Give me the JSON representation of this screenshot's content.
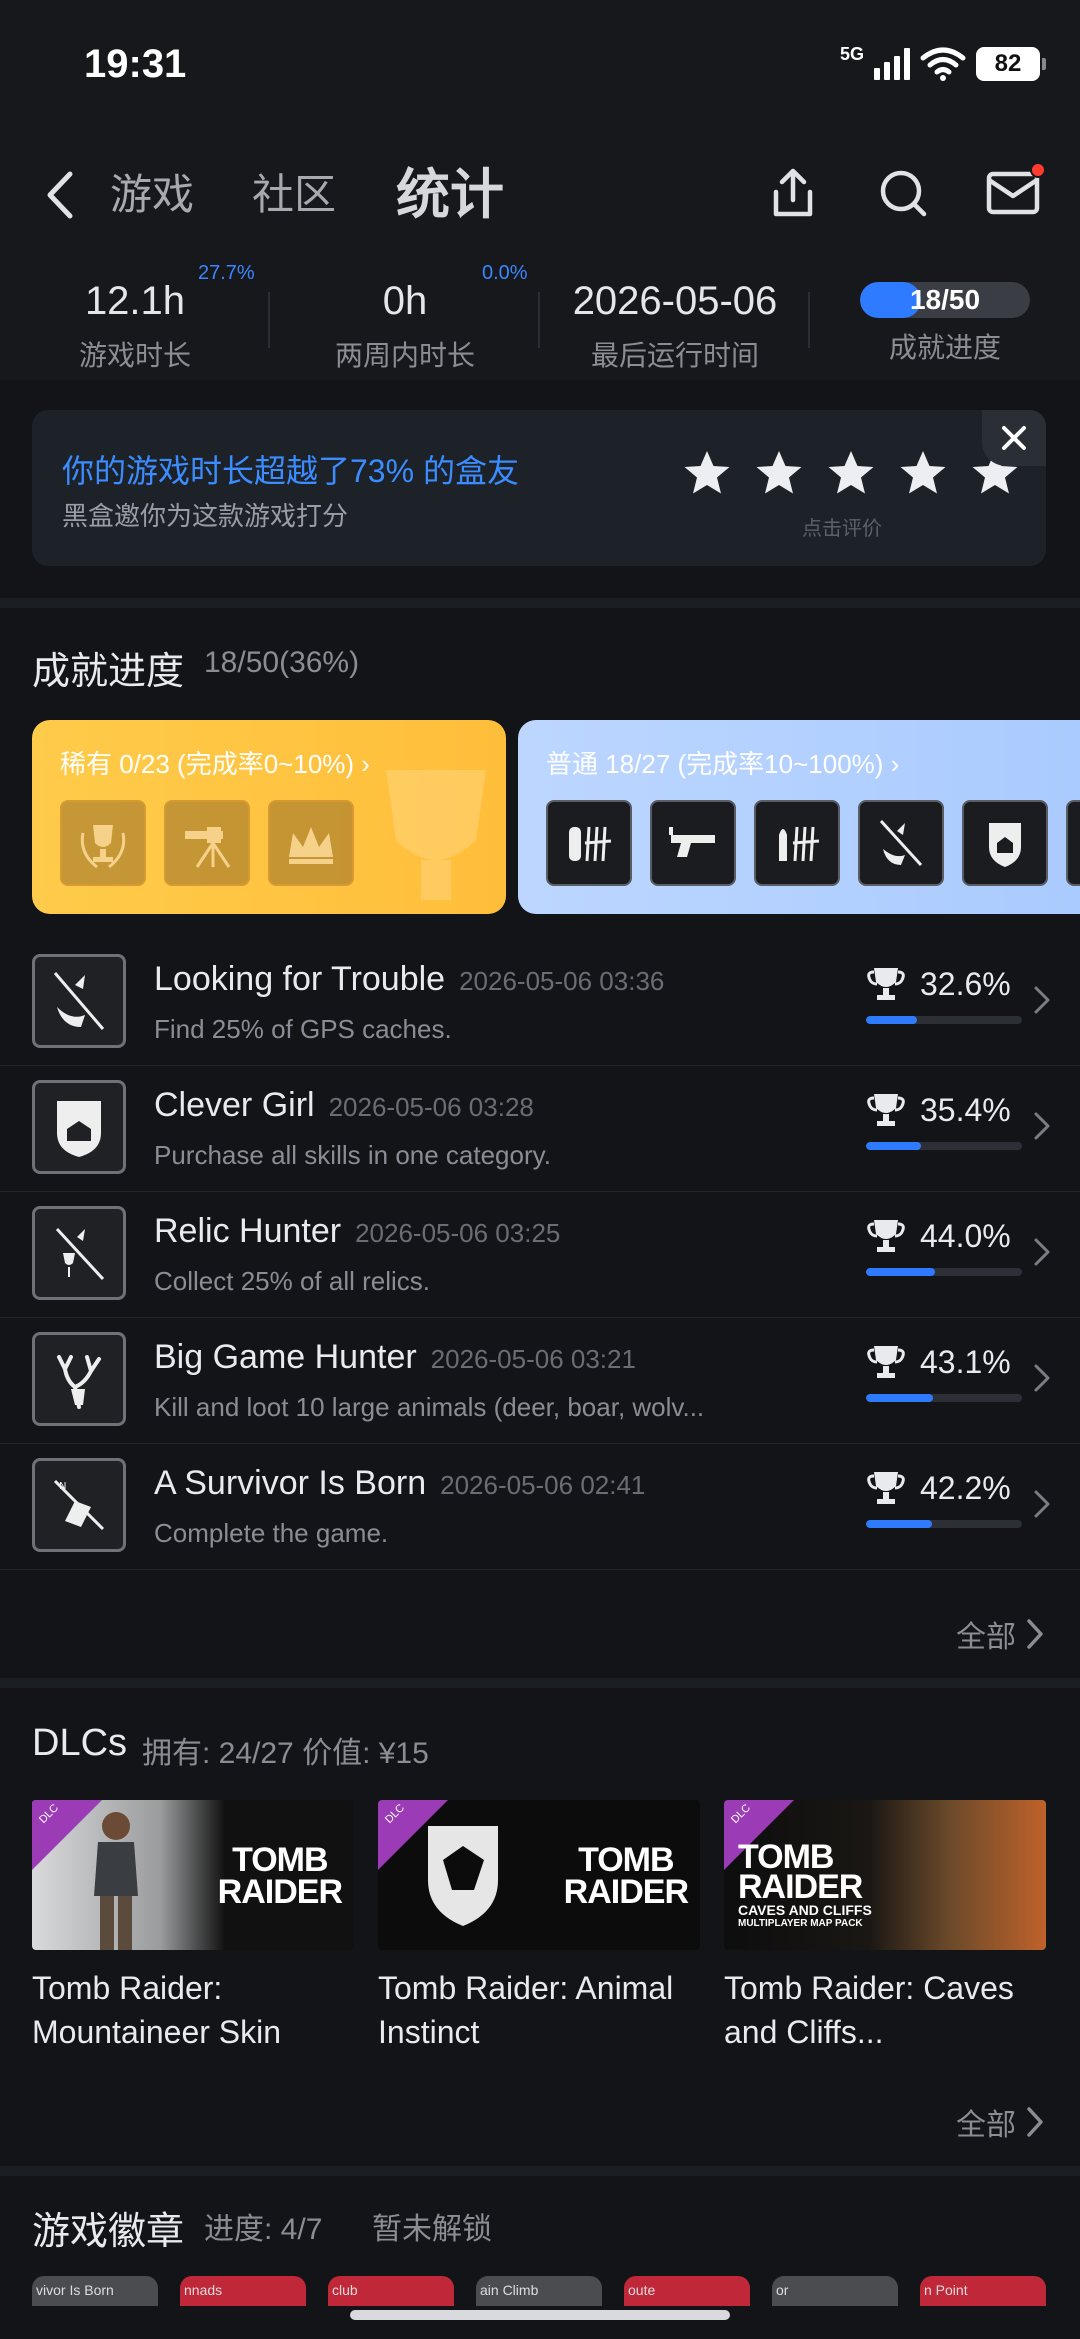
{
  "status": {
    "time": "19:31",
    "network": "5G",
    "battery": "82"
  },
  "nav": {
    "tabs": [
      "游戏",
      "社区",
      "统计"
    ],
    "active_tab": "统计"
  },
  "stats": [
    {
      "value": "12.1h",
      "delta": "27.7%",
      "label": "游戏时长"
    },
    {
      "value": "0h",
      "delta": "0.0%",
      "label": "两周内时长"
    },
    {
      "value": "2026-05-06",
      "label": "最后运行时间"
    },
    {
      "value": "18/50",
      "label": "成就进度",
      "progress": 0.36
    }
  ],
  "rating": {
    "title": "你的游戏时长超越了73% 的盒友",
    "subtitle": "黑盒邀你为这款游戏打分",
    "hint": "点击评价",
    "stars": 5
  },
  "achievements_section": {
    "title": "成就进度",
    "summary": "18/50(36%)",
    "rare_label": "稀有 0/23 (完成率0~10%) ›",
    "common_label": "普通 18/27 (完成率10~100%) ›",
    "items": [
      {
        "name": "Looking for Trouble",
        "date": "2026-05-06 03:36",
        "desc": "Find 25% of GPS caches.",
        "pct": "32.6%",
        "ratio": 0.326
      },
      {
        "name": "Clever Girl",
        "date": "2026-05-06 03:28",
        "desc": "Purchase all skills in one category.",
        "pct": "35.4%",
        "ratio": 0.354
      },
      {
        "name": "Relic Hunter",
        "date": "2026-05-06 03:25",
        "desc": "Collect 25% of all relics.",
        "pct": "44.0%",
        "ratio": 0.44
      },
      {
        "name": "Big Game Hunter",
        "date": "2026-05-06 03:21",
        "desc": "Kill and loot 10 large animals (deer, boar, wolv...",
        "pct": "43.1%",
        "ratio": 0.431
      },
      {
        "name": "A Survivor Is Born",
        "date": "2026-05-06 02:41",
        "desc": "Complete the game.",
        "pct": "42.2%",
        "ratio": 0.422
      }
    ],
    "all_label": "全部"
  },
  "dlcs": {
    "title": "DLCs",
    "summary": "拥有: 24/27 价值: ¥15",
    "badge": "DLC",
    "logo_line1": "TOMB",
    "logo_line2": "RAIDER",
    "cliffs_sub": "CAVES AND CLIFFS",
    "cliffs_sub2": "MULTIPLAYER MAP PACK",
    "items": [
      {
        "name": "Tomb Raider: Mountaineer Skin"
      },
      {
        "name": "Tomb Raider: Animal Instinct"
      },
      {
        "name": "Tomb Raider: Caves and Cliffs..."
      }
    ],
    "all_label": "全部"
  },
  "badges": {
    "title": "游戏徽章",
    "progress": "进度: 4/7",
    "status": "暂未解锁",
    "items": [
      "vivor Is Born",
      "nnads",
      "club",
      "ain Climb",
      "oute",
      "or",
      "n Point"
    ]
  },
  "colors": {
    "accent": "#2f7bff",
    "rare": "#ffc443",
    "common": "#b2cfff",
    "bg": "#121418"
  }
}
